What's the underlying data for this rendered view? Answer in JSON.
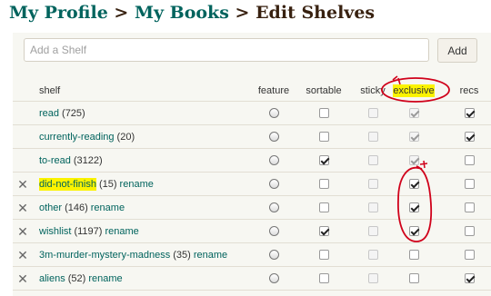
{
  "breadcrumb": {
    "profile": "My Profile",
    "books": "My Books",
    "current": "Edit Shelves",
    "separator": ">"
  },
  "add_shelf": {
    "placeholder": "Add a Shelf",
    "button_label": "Add"
  },
  "columns": {
    "shelf": "shelf",
    "feature": "feature",
    "sortable": "sortable",
    "sticky": "sticky",
    "exclusive": "exclusive",
    "recs": "recs"
  },
  "rows": [
    {
      "name": "read",
      "count": "(725)",
      "rename": "",
      "deletable": false,
      "highlight": false,
      "sortable": false,
      "sticky": false,
      "exclusive": true,
      "exclusive_disabled": true,
      "recs": true
    },
    {
      "name": "currently-reading",
      "count": "(20)",
      "rename": "",
      "deletable": false,
      "highlight": false,
      "sortable": false,
      "sticky": false,
      "exclusive": true,
      "exclusive_disabled": true,
      "recs": true
    },
    {
      "name": "to-read",
      "count": "(3122)",
      "rename": "",
      "deletable": false,
      "highlight": false,
      "sortable": true,
      "sticky": false,
      "exclusive": true,
      "exclusive_disabled": true,
      "recs": false
    },
    {
      "name": "did-not-finish",
      "count": "(15)",
      "rename": "rename",
      "deletable": true,
      "highlight": true,
      "sortable": false,
      "sticky": false,
      "exclusive": true,
      "exclusive_disabled": false,
      "recs": false
    },
    {
      "name": "other",
      "count": "(146)",
      "rename": "rename",
      "deletable": true,
      "highlight": false,
      "sortable": false,
      "sticky": false,
      "exclusive": true,
      "exclusive_disabled": false,
      "recs": false
    },
    {
      "name": "wishlist",
      "count": "(1197)",
      "rename": "rename",
      "deletable": true,
      "highlight": false,
      "sortable": true,
      "sticky": false,
      "exclusive": true,
      "exclusive_disabled": false,
      "recs": false
    },
    {
      "name": "3m-murder-mystery-madness",
      "count": "(35)",
      "rename": "rename",
      "deletable": true,
      "highlight": false,
      "sortable": false,
      "sticky": false,
      "exclusive": false,
      "exclusive_disabled": false,
      "recs": false
    },
    {
      "name": "aliens",
      "count": "(52)",
      "rename": "rename",
      "deletable": true,
      "highlight": false,
      "sortable": false,
      "sticky": false,
      "exclusive": false,
      "exclusive_disabled": false,
      "recs": true
    }
  ],
  "icons": {
    "delete": "close-icon",
    "feature": "radio-button"
  },
  "colors": {
    "link": "#00635d",
    "heading": "#382110",
    "highlight": "#fbf300",
    "annotation": "#d0021b"
  }
}
